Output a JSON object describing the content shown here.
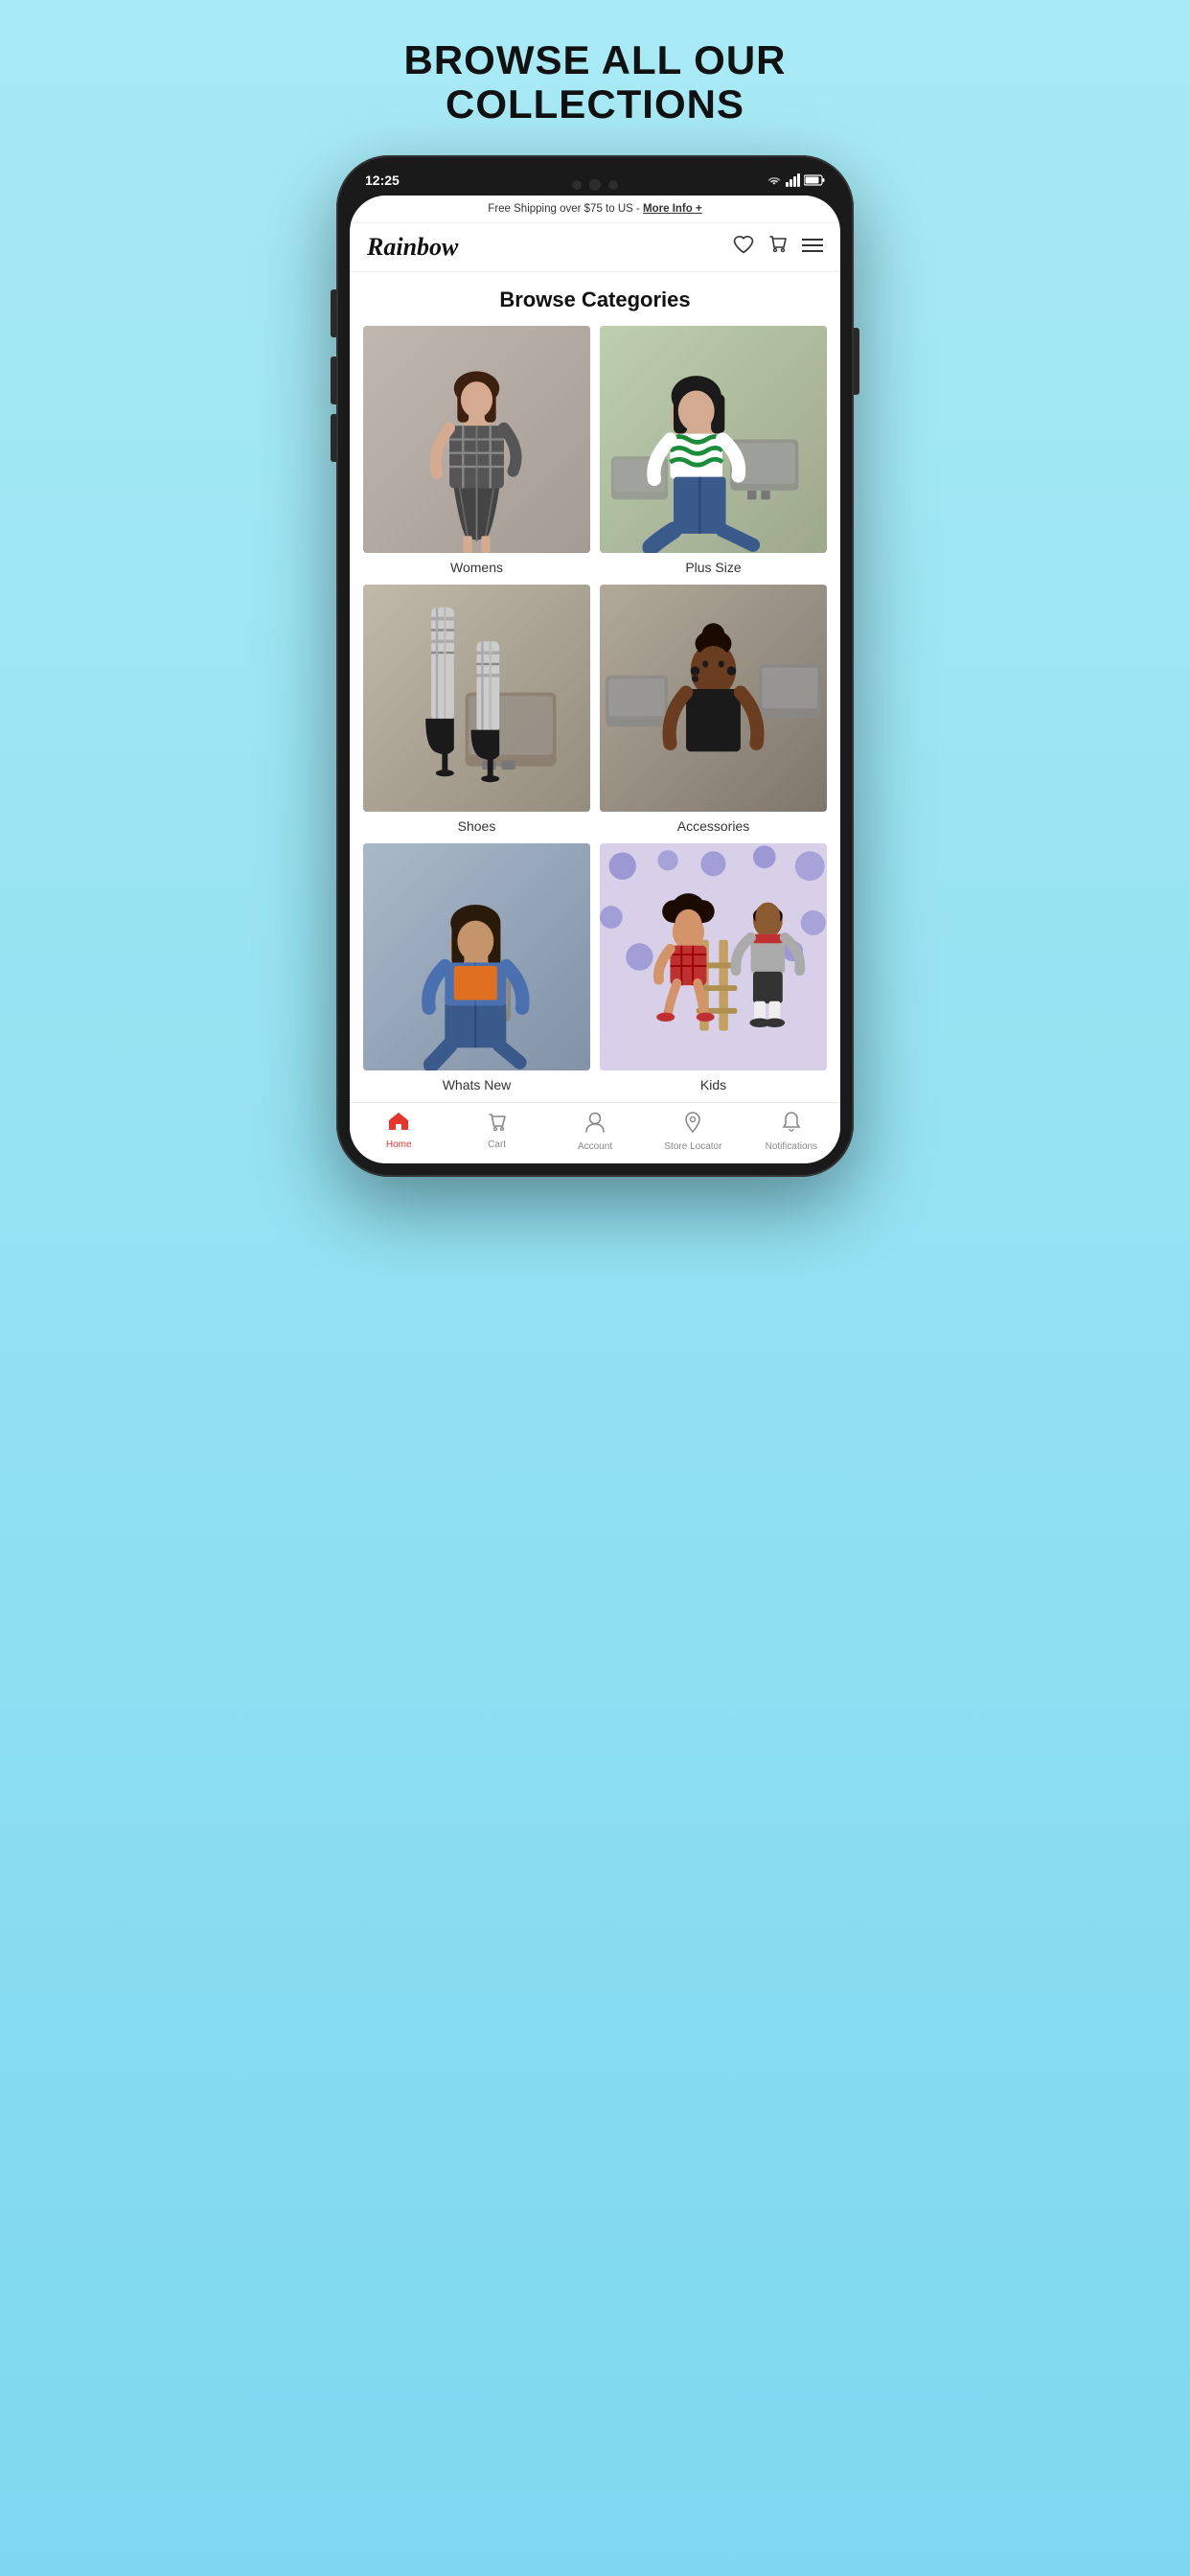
{
  "page": {
    "headline_line1": "BROWSE ALL OUR",
    "headline_line2": "COLLECTIONS"
  },
  "status_bar": {
    "time": "12:25"
  },
  "banner": {
    "text": "Free Shipping over $75 to US -",
    "link": "More Info +"
  },
  "header": {
    "logo": "Rainbow",
    "wishlist_icon": "heart-icon",
    "cart_icon": "cart-icon",
    "menu_icon": "menu-icon"
  },
  "browse": {
    "title": "Browse Categories"
  },
  "categories": [
    {
      "id": "womens",
      "label": "Womens",
      "class": "womens"
    },
    {
      "id": "plus-size",
      "label": "Plus Size",
      "class": "plus-size"
    },
    {
      "id": "shoes",
      "label": "Shoes",
      "class": "shoes"
    },
    {
      "id": "accessories",
      "label": "Accessories",
      "class": "accessories"
    },
    {
      "id": "whats-new",
      "label": "Whats New",
      "class": "whats-new"
    },
    {
      "id": "kids",
      "label": "Kids",
      "class": "kids"
    }
  ],
  "bottom_nav": [
    {
      "id": "home",
      "label": "Home",
      "icon": "🏠",
      "active": true
    },
    {
      "id": "cart",
      "label": "Cart",
      "icon": "🛒",
      "active": false
    },
    {
      "id": "account",
      "label": "Account",
      "icon": "👤",
      "active": false
    },
    {
      "id": "store-locator",
      "label": "Store Locator",
      "icon": "📍",
      "active": false
    },
    {
      "id": "notifications",
      "label": "Notifications",
      "icon": "🔔",
      "active": false
    }
  ]
}
